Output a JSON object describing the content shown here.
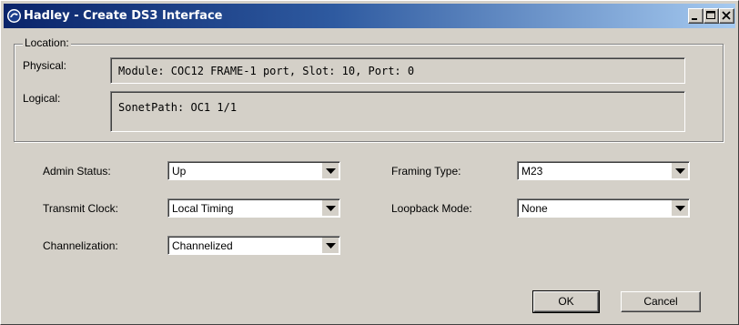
{
  "window": {
    "title": "Hadley - Create DS3 Interface",
    "controls": {
      "minimize": "minimize-icon",
      "maximize": "maximize-icon",
      "close": "close-icon"
    }
  },
  "location": {
    "legend": "Location:",
    "physical_label": "Physical:",
    "physical_value": "Module: COC12 FRAME-1 port, Slot: 10, Port: 0",
    "logical_label": "Logical:",
    "logical_value": "SonetPath: OC1 1/1"
  },
  "settings": {
    "admin_status": {
      "label": "Admin Status:",
      "value": "Up"
    },
    "transmit_clock": {
      "label": "Transmit Clock:",
      "value": "Local Timing"
    },
    "channelization": {
      "label": "Channelization:",
      "value": "Channelized"
    },
    "framing_type": {
      "label": "Framing Type:",
      "value": "M23"
    },
    "loopback_mode": {
      "label": "Loopback Mode:",
      "value": "None"
    }
  },
  "buttons": {
    "ok": "OK",
    "cancel": "Cancel"
  },
  "colors": {
    "title_start": "#0a246a",
    "title_end": "#a6caf0",
    "face": "#d4d0c8"
  }
}
